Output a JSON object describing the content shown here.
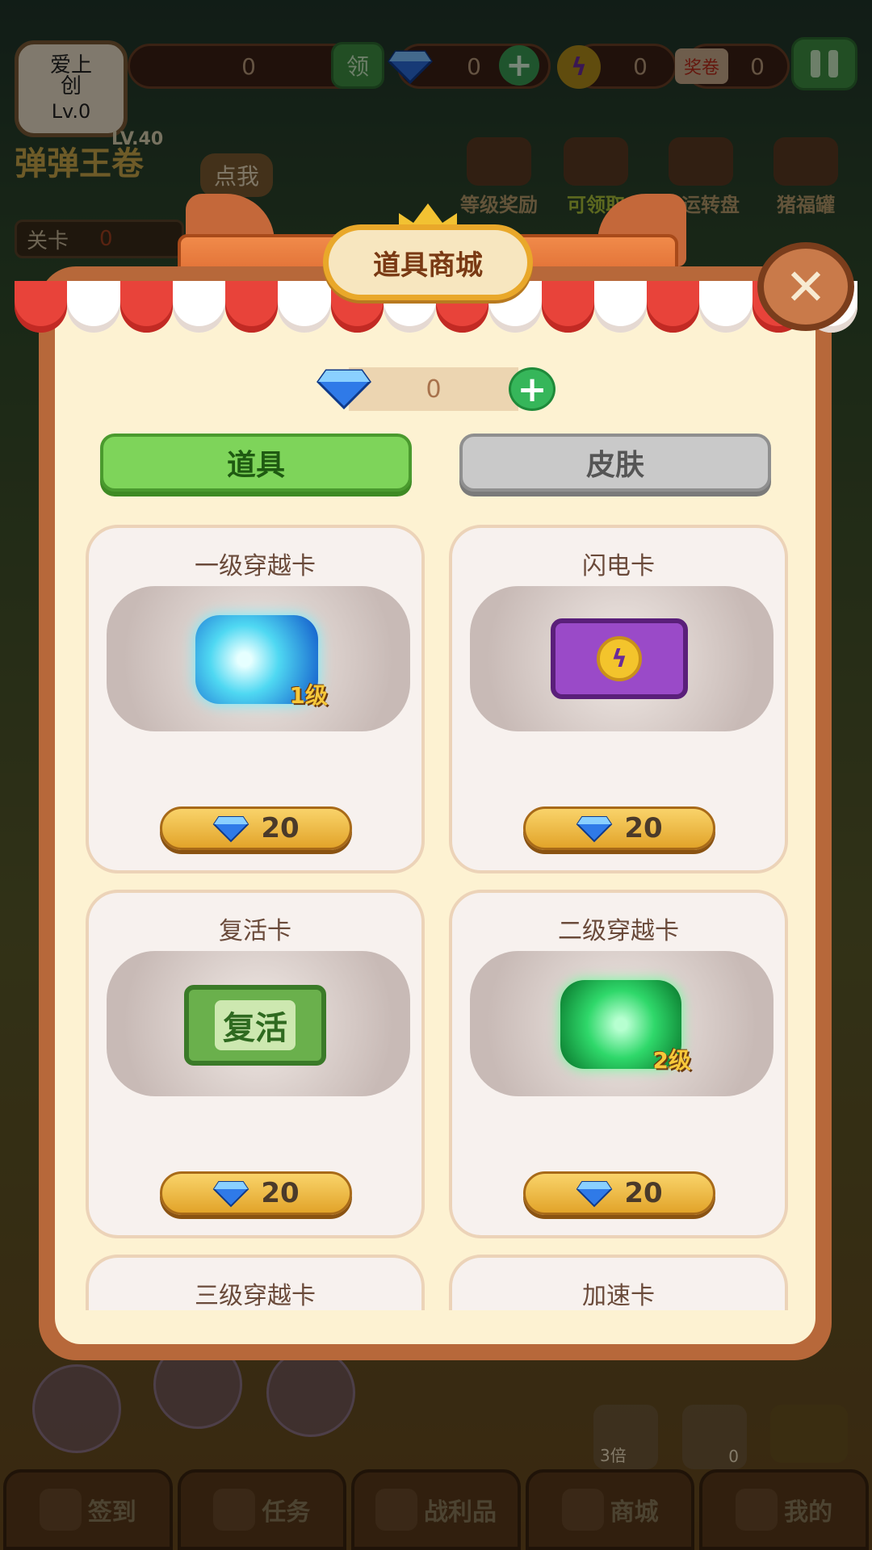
{
  "topbar": {
    "avatar_name": "爱上创",
    "avatar_level": "Lv.0",
    "coin_value": "0",
    "claim_label": "领",
    "gem_value": "0",
    "bolt_value": "0",
    "ticket_label": "奖卷",
    "ticket_value": "0"
  },
  "row2": {
    "logo_text": "弹弹王卷",
    "logo_level": "LV.40",
    "tap_label": "点我",
    "features": [
      {
        "label": "等级奖励"
      },
      {
        "label": "可领取"
      },
      {
        "label": "幸运转盘"
      },
      {
        "label": "猪福罐"
      }
    ],
    "level_label": "关卡",
    "level_value": "0"
  },
  "modal": {
    "title": "道具商城",
    "close_symbol": "✕",
    "balance": "0",
    "tabs": [
      {
        "label": "道具",
        "active": true
      },
      {
        "label": "皮肤",
        "active": false
      }
    ],
    "items": [
      {
        "name": "一级穿越卡",
        "price": "20",
        "level_tag": "1级"
      },
      {
        "name": "闪电卡",
        "price": "20"
      },
      {
        "name": "复活卡",
        "price": "20",
        "note_text": "复活"
      },
      {
        "name": "二级穿越卡",
        "price": "20",
        "level_tag": "2级"
      },
      {
        "name": "三级穿越卡"
      },
      {
        "name": "加速卡"
      }
    ]
  },
  "bottom_nav": [
    {
      "label": "签到"
    },
    {
      "label": "任务"
    },
    {
      "label": "战利品"
    },
    {
      "label": "商城"
    },
    {
      "label": "我的"
    }
  ],
  "side": {
    "multiplier": "3倍",
    "count": "0"
  },
  "colors": {
    "modal_border": "#b7683a",
    "modal_bg": "#fdf2d2",
    "tab_active": "#7ed45a",
    "tab_inactive": "#c9c9c9",
    "price_gold": "#f9d36a",
    "awning_red": "#e8433a"
  }
}
